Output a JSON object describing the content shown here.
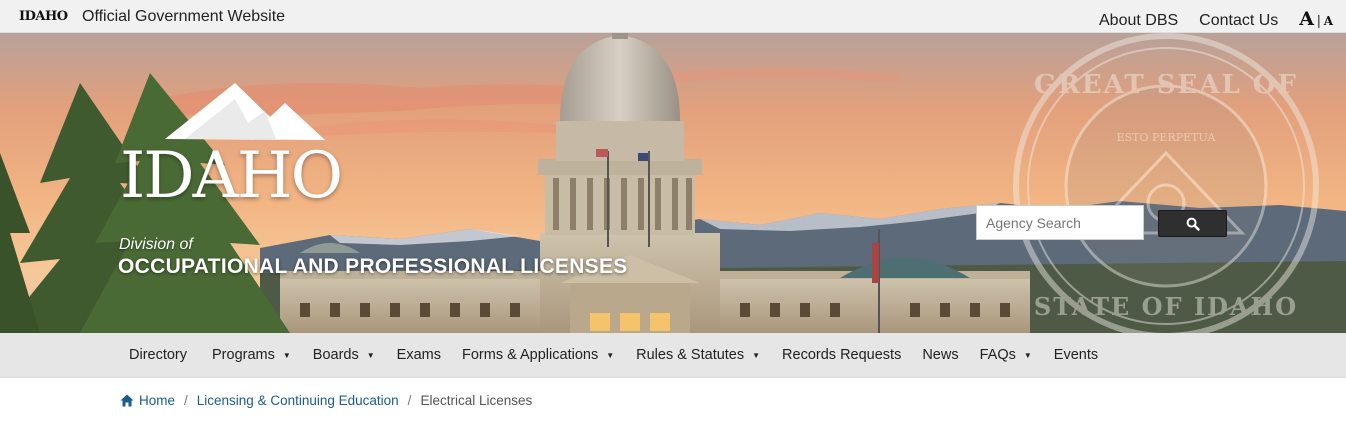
{
  "topbar": {
    "logo": "IDAHO",
    "official": "Official Government Website",
    "links": [
      "About DBS",
      "Contact Us"
    ],
    "font_size_large": "A",
    "font_size_sep": "|",
    "font_size_small": "A"
  },
  "hero": {
    "brand_state": "IDAHO",
    "division_label": "Division of",
    "division_name": "OCCUPATIONAL AND PROFESSIONAL LICENSES",
    "search_placeholder": "Agency Search",
    "seal_text_top": "GREAT SEAL OF THE",
    "seal_text_bottom": "STATE OF IDAHO",
    "seal_motto": "ESTO PERPETUA"
  },
  "nav": {
    "items": [
      {
        "label": "Directory",
        "dropdown": false
      },
      {
        "label": "Programs",
        "dropdown": true
      },
      {
        "label": "Boards",
        "dropdown": true
      },
      {
        "label": "Exams",
        "dropdown": false
      },
      {
        "label": "Forms & Applications",
        "dropdown": true
      },
      {
        "label": "Rules & Statutes",
        "dropdown": true
      },
      {
        "label": "Records Requests",
        "dropdown": false
      },
      {
        "label": "News",
        "dropdown": false
      },
      {
        "label": "FAQs",
        "dropdown": true
      },
      {
        "label": "Events",
        "dropdown": false
      }
    ]
  },
  "breadcrumb": {
    "home": "Home",
    "parent": "Licensing & Continuing Education",
    "current": "Electrical Licenses",
    "separator": "/"
  },
  "colors": {
    "topbar_bg": "#f1f1f1",
    "nav_bg": "#e6e6e6",
    "link": "#1b5c8c",
    "search_button": "#2f2f2f"
  },
  "icons": {
    "search_button": "search-icon",
    "home": "home-icon",
    "nav_caret": "caret-down-icon"
  }
}
